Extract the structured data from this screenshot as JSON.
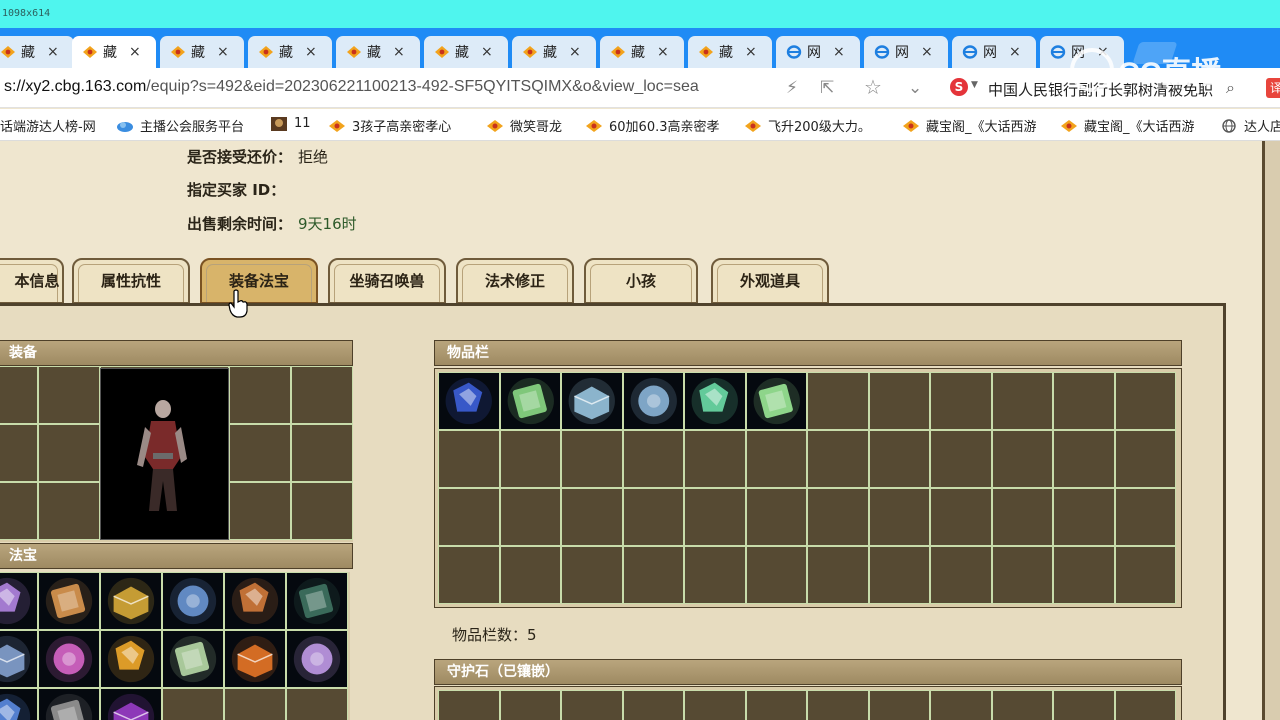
{
  "browser": {
    "dims_label": "1098x614",
    "tabs": [
      {
        "label": "藏",
        "icon": "treasure-icon",
        "active": false
      },
      {
        "label": "藏",
        "icon": "treasure-icon",
        "active": true
      },
      {
        "label": "藏",
        "icon": "treasure-icon",
        "active": false
      },
      {
        "label": "藏",
        "icon": "treasure-icon",
        "active": false
      },
      {
        "label": "藏",
        "icon": "treasure-icon",
        "active": false
      },
      {
        "label": "藏",
        "icon": "treasure-icon",
        "active": false
      },
      {
        "label": "藏",
        "icon": "treasure-icon",
        "active": false
      },
      {
        "label": "藏",
        "icon": "treasure-icon",
        "active": false
      },
      {
        "label": "藏",
        "icon": "treasure-icon",
        "active": false
      },
      {
        "label": "网",
        "icon": "ie-icon",
        "active": false
      },
      {
        "label": "网",
        "icon": "ie-icon",
        "active": false
      },
      {
        "label": "网",
        "icon": "ie-icon",
        "active": false
      },
      {
        "label": "网",
        "icon": "ie-icon",
        "active": false
      }
    ],
    "url_prefix": "s://xy2.cbg.163.com",
    "url_rest": "/equip?s=492&eid=202306221100213-492-SF5QYITSQIMX&o&view_loc=sea",
    "news_text": "中国人民银行副行长郭树清被免职",
    "translate_label": "译",
    "search_engine_label": "S",
    "bookmarks": [
      {
        "label": "话端游达人榜-网",
        "icon": "none"
      },
      {
        "label": "主播公会服务平台",
        "icon": "cloud-icon"
      },
      {
        "label": "11",
        "icon": "game-icon"
      },
      {
        "label": "3孩子高亲密孝心",
        "icon": "treasure-icon"
      },
      {
        "label": "微笑哥龙",
        "icon": "treasure-icon"
      },
      {
        "label": "60加60.3高亲密孝",
        "icon": "treasure-icon"
      },
      {
        "label": "飞升200级大力。",
        "icon": "treasure-icon"
      },
      {
        "label": "藏宝阁_《大话西游",
        "icon": "treasure-icon"
      },
      {
        "label": "藏宝阁_《大话西游",
        "icon": "treasure-icon"
      },
      {
        "label": "达人店",
        "icon": "globe-icon"
      }
    ]
  },
  "watermark": {
    "text": "CC直播"
  },
  "listing": {
    "accept_counter_key": "是否接受还价：",
    "accept_counter_value": "拒绝",
    "buyer_id_key": "指定买家 ID：",
    "buyer_id_value": "",
    "remaining_key": "出售剩余时间：",
    "remaining_value": "9天16时"
  },
  "game_tabs": [
    {
      "label": "本信息",
      "selected": false
    },
    {
      "label": "属性抗性",
      "selected": false
    },
    {
      "label": "装备法宝",
      "selected": true
    },
    {
      "label": "坐骑召唤兽",
      "selected": false
    },
    {
      "label": "法术修正",
      "selected": false
    },
    {
      "label": "小孩",
      "selected": false
    },
    {
      "label": "外观道具",
      "selected": false
    }
  ],
  "sections": {
    "equipment_title": "装备",
    "fabao_title": "法宝",
    "inventory_title": "物品栏",
    "inventory_count_label": "物品栏数：",
    "inventory_count_value": "5",
    "guard_stone_title": "守护石（已镶嵌）"
  },
  "inventory_items": [
    {
      "icon": "blue-crystal-icon",
      "color": "#3d5fd8"
    },
    {
      "icon": "green-jade-icon",
      "color": "#7fc77a"
    },
    {
      "icon": "ice-box-icon",
      "color": "#9ecde6"
    },
    {
      "icon": "ice-box-icon",
      "color": "#8fbbe0"
    },
    {
      "icon": "green-scroll-icon",
      "color": "#6cdca6"
    },
    {
      "icon": "green-scroll-icon",
      "color": "#8ed58a"
    }
  ],
  "fabao_items": [
    {
      "icon": "purple-gauntlet-icon",
      "color": "#b184e0"
    },
    {
      "icon": "lute-icon",
      "color": "#c98b4a"
    },
    {
      "icon": "golden-pagoda-icon",
      "color": "#e0b23a"
    },
    {
      "icon": "blue-claw-icon",
      "color": "#6e9bdc"
    },
    {
      "icon": "orange-tablet-icon",
      "color": "#d07a3a"
    },
    {
      "icon": "dark-orb-icon",
      "color": "#3a6a5a"
    },
    {
      "icon": "scroll-bundle-icon",
      "color": "#8aa8d8"
    },
    {
      "icon": "pink-lantern-icon",
      "color": "#e06ad0"
    },
    {
      "icon": "golden-cloud-icon",
      "color": "#f0a82a"
    },
    {
      "icon": "jade-block-icon",
      "color": "#a8c89a"
    },
    {
      "icon": "orange-scroll-icon",
      "color": "#f07a28"
    },
    {
      "icon": "violet-claw-icon",
      "color": "#c8a0f0"
    },
    {
      "icon": "blue-rune-icon",
      "color": "#5a8ae0"
    },
    {
      "icon": "grey-feather-icon",
      "color": "#8a8a8a"
    },
    {
      "icon": "purple-whip-icon",
      "color": "#a040d0"
    }
  ],
  "colors": {
    "tabbar": "#1f8bf5",
    "cell_bg": "#564a33",
    "panel_bg": "#e7dcc0",
    "selected_tab": "#d8b46a"
  }
}
